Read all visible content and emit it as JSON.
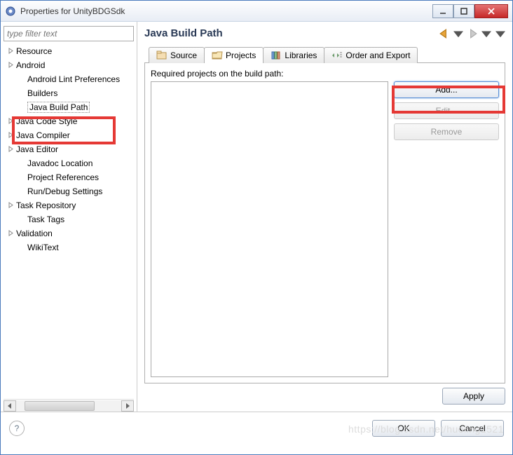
{
  "window": {
    "title": "Properties for UnityBDGSdk"
  },
  "sidebar": {
    "filter_placeholder": "type filter text",
    "items": [
      {
        "label": "Resource",
        "expandable": true,
        "child": false
      },
      {
        "label": "Android",
        "expandable": true,
        "child": false
      },
      {
        "label": "Android Lint Preferences",
        "expandable": false,
        "child": true
      },
      {
        "label": "Builders",
        "expandable": false,
        "child": true
      },
      {
        "label": "Java Build Path",
        "expandable": false,
        "child": true,
        "selected": true
      },
      {
        "label": "Java Code Style",
        "expandable": true,
        "child": false
      },
      {
        "label": "Java Compiler",
        "expandable": true,
        "child": false
      },
      {
        "label": "Java Editor",
        "expandable": true,
        "child": false
      },
      {
        "label": "Javadoc Location",
        "expandable": false,
        "child": true
      },
      {
        "label": "Project References",
        "expandable": false,
        "child": true
      },
      {
        "label": "Run/Debug Settings",
        "expandable": false,
        "child": true
      },
      {
        "label": "Task Repository",
        "expandable": true,
        "child": false
      },
      {
        "label": "Task Tags",
        "expandable": false,
        "child": true
      },
      {
        "label": "Validation",
        "expandable": true,
        "child": false
      },
      {
        "label": "WikiText",
        "expandable": false,
        "child": true
      }
    ]
  },
  "page": {
    "heading": "Java Build Path",
    "tabs": {
      "source": "Source",
      "projects": "Projects",
      "libraries": "Libraries",
      "order": "Order and Export"
    },
    "required_label": "Required projects on the build path:",
    "buttons": {
      "add": "Add...",
      "edit": "Edit...",
      "remove": "Remove",
      "apply": "Apply"
    }
  },
  "footer": {
    "ok": "OK",
    "cancel": "Cancel"
  },
  "watermark": "https://blog.csdn.net/huoling1521"
}
